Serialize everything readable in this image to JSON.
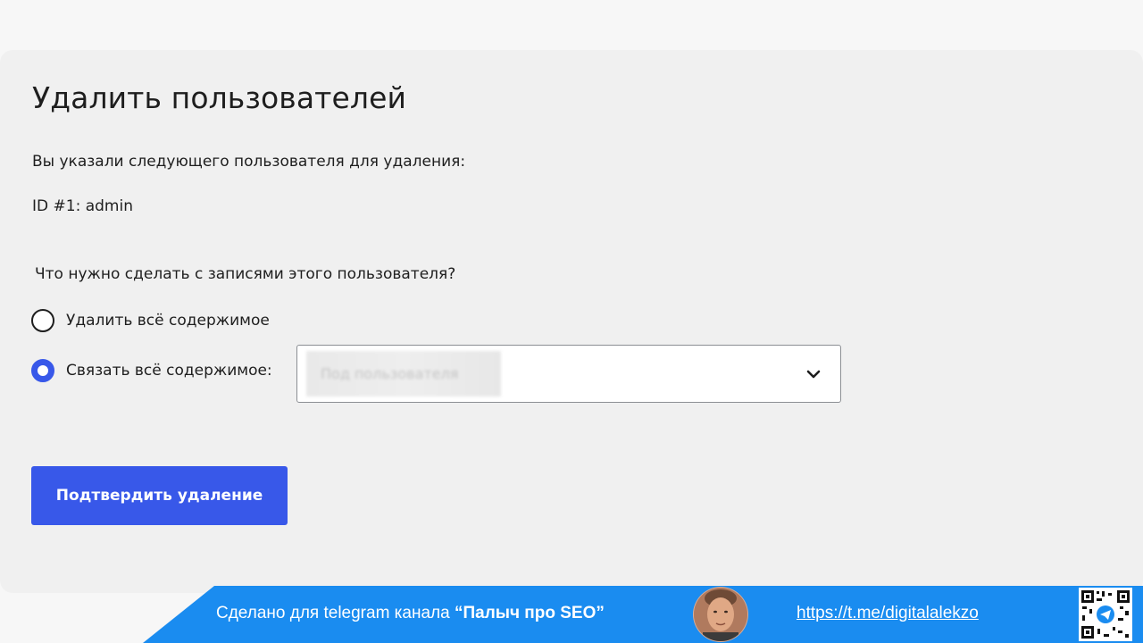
{
  "page": {
    "title": "Удалить пользователей",
    "intro": "Вы указали следующего пользователя для удаления:",
    "user_id": "ID #1: admin",
    "question": "Что нужно сделать с записями этого пользователя?"
  },
  "options": {
    "delete_label": "Удалить всё содержимое",
    "attach_label": "Связать всё содержимое:",
    "selected": "attach"
  },
  "select": {
    "value": "Под пользователя"
  },
  "actions": {
    "confirm_label": "Подтвердить удаление"
  },
  "banner": {
    "text_prefix": "Сделано для telegram канала ",
    "channel_name": "“Палыч про SEO”",
    "link": "https://t.me/digitalalekzo"
  },
  "colors": {
    "accent": "#3858e9",
    "banner_blue": "#1a8cf0",
    "panel_bg": "#f0f0f0"
  },
  "icons": {
    "dropdown": "chevron-down-icon",
    "qr": "qr-code-icon",
    "telegram": "telegram-icon"
  }
}
